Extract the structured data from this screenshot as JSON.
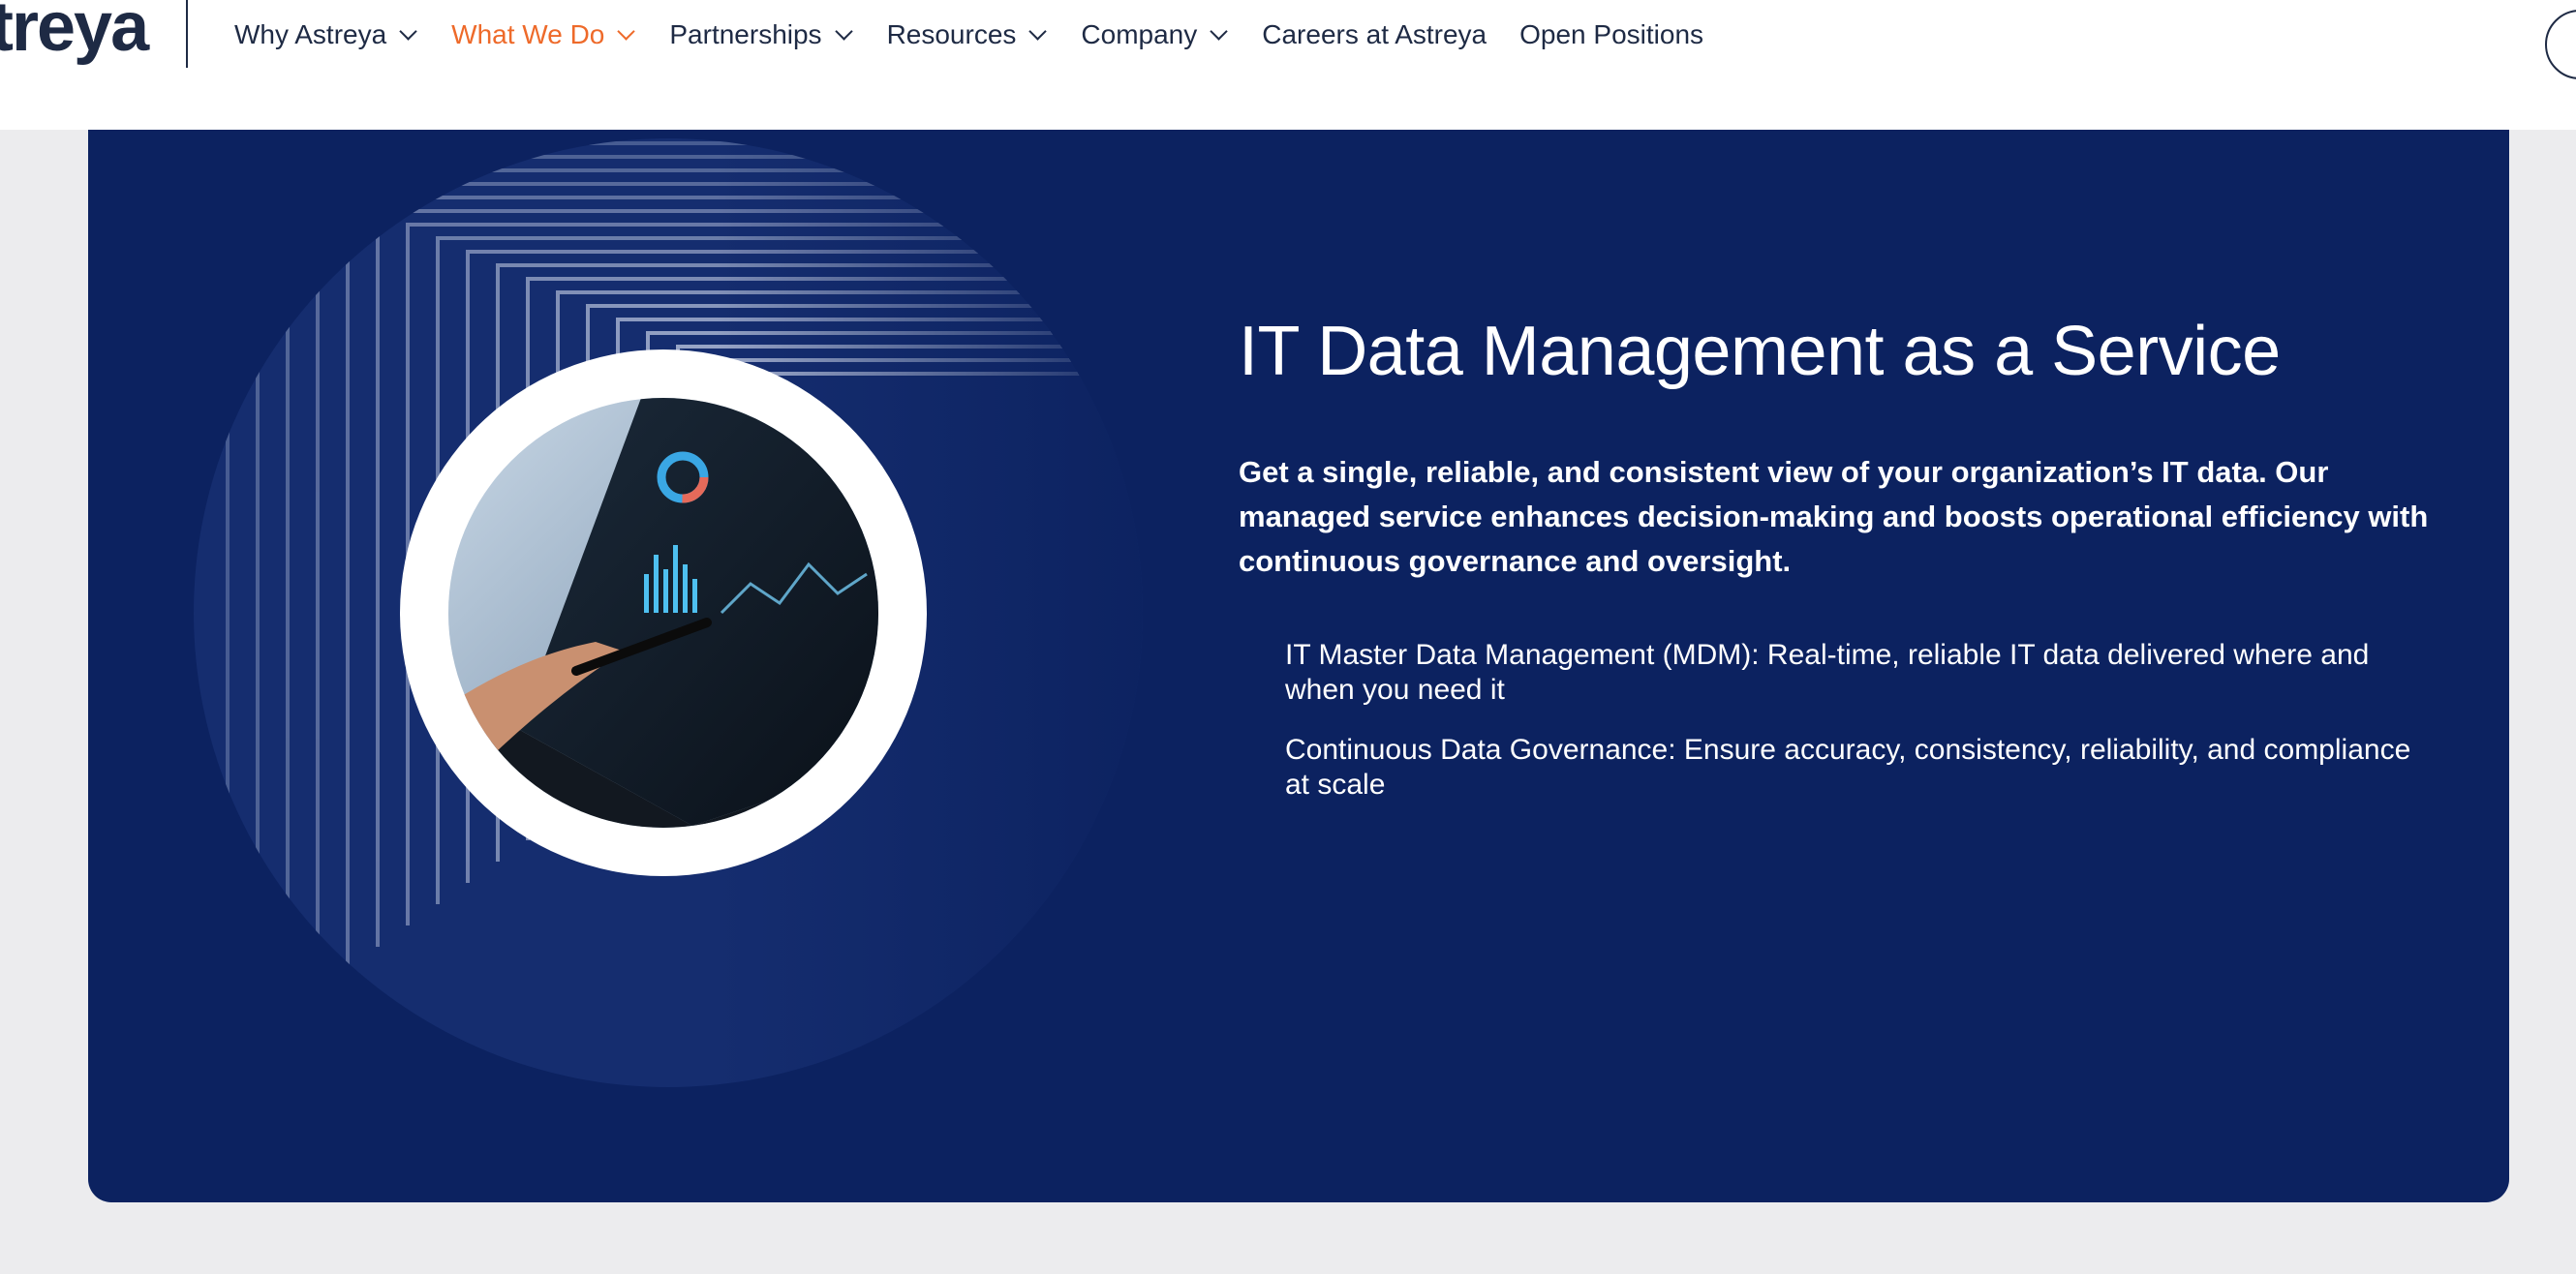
{
  "header": {
    "logo_text": "treya",
    "nav": [
      {
        "label": "Why Astreya",
        "has_dropdown": true,
        "active": false
      },
      {
        "label": "What We Do",
        "has_dropdown": true,
        "active": true
      },
      {
        "label": "Partnerships",
        "has_dropdown": true,
        "active": false
      },
      {
        "label": "Resources",
        "has_dropdown": true,
        "active": false
      },
      {
        "label": "Company",
        "has_dropdown": true,
        "active": false
      },
      {
        "label": "Careers at Astreya",
        "has_dropdown": false,
        "active": false
      },
      {
        "label": "Open Positions",
        "has_dropdown": false,
        "active": false
      }
    ],
    "accent_color": "#ee6a2a"
  },
  "hero": {
    "title": "IT Data Management as a Service",
    "intro": "Get a single, reliable, and consistent view of your organization’s IT data. Our managed service enhances decision-making and boosts operational efficiency with continuous governance and oversight.",
    "bullets": [
      "IT Master Data Management (MDM): Real-time, reliable IT data delivered where and when you need it",
      "Continuous Data Governance: Ensure accuracy, consistency, reliability, and compliance at scale"
    ],
    "background_color": "#0c2260",
    "image_icon": "tablet-analytics-photo"
  }
}
